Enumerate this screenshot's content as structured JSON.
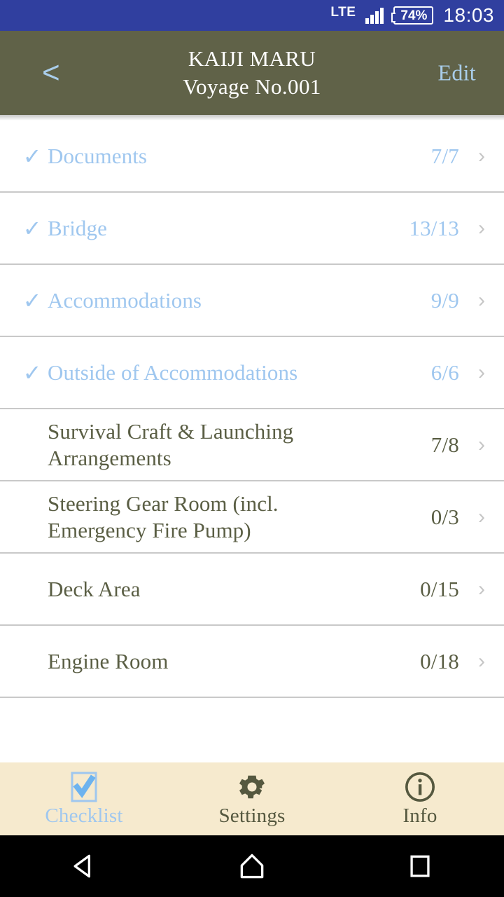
{
  "status_bar": {
    "network": "LTE",
    "battery_percent": "74%",
    "time": "18:03",
    "background_color": "#303f9f"
  },
  "header": {
    "back_label": "<",
    "title_line1": "KAIJI MARU",
    "title_line2": "Voyage No.001",
    "edit_label": "Edit",
    "background_color": "#606248",
    "accent_color": "#a9cdea"
  },
  "checklist": {
    "done_color": "#9fc7ef",
    "pending_color": "#5a5e44",
    "check_glyph": "✓",
    "chevron_glyph": "›",
    "items": [
      {
        "label": "Documents",
        "count": "7/7",
        "done": true
      },
      {
        "label": "Bridge",
        "count": "13/13",
        "done": true
      },
      {
        "label": "Accommodations",
        "count": "9/9",
        "done": true
      },
      {
        "label": "Outside of Accommodations",
        "count": "6/6",
        "done": true
      },
      {
        "label": "Survival Craft & Launching Arrangements",
        "count": "7/8",
        "done": false
      },
      {
        "label": "Steering Gear Room (incl. Emergency Fire Pump)",
        "count": "0/3",
        "done": false
      },
      {
        "label": "Deck Area",
        "count": "0/15",
        "done": false
      },
      {
        "label": "Engine Room",
        "count": "0/18",
        "done": false
      }
    ]
  },
  "tab_bar": {
    "background_color": "#f6eace",
    "active_color": "#9fc7ef",
    "inactive_color": "#55583f",
    "tabs": [
      {
        "label": "Checklist",
        "icon": "checkbox-checked-icon",
        "active": true
      },
      {
        "label": "Settings",
        "icon": "gear-icon",
        "active": false
      },
      {
        "label": "Info",
        "icon": "info-circle-icon",
        "active": false
      }
    ]
  },
  "nav_bar": {
    "buttons": [
      {
        "name": "back",
        "icon": "triangle-back-icon"
      },
      {
        "name": "home",
        "icon": "home-icon"
      },
      {
        "name": "recents",
        "icon": "square-recents-icon"
      }
    ]
  }
}
